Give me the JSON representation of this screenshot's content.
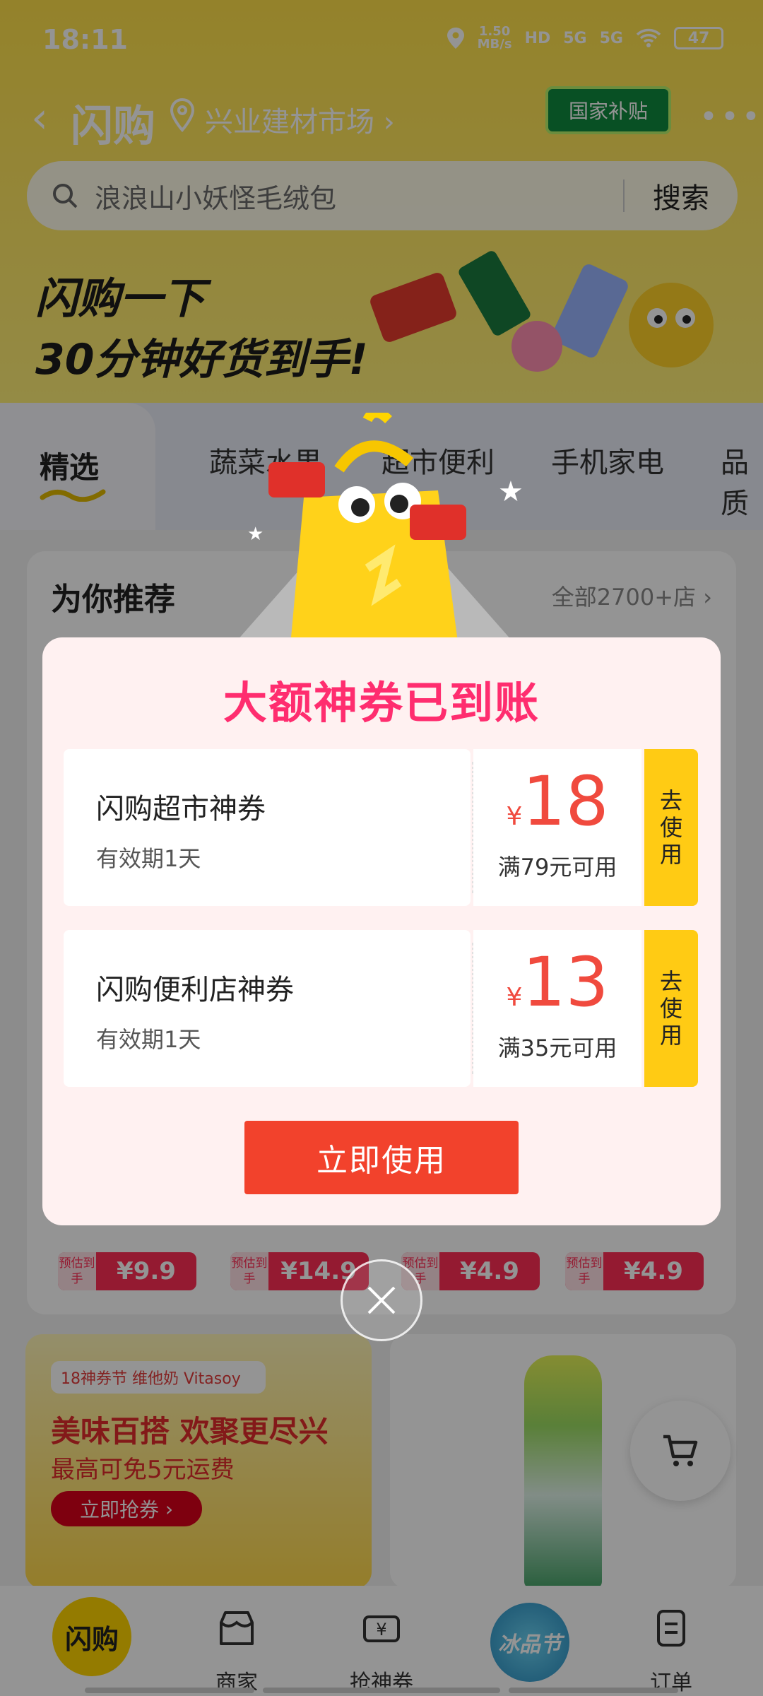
{
  "status_bar": {
    "time": "18:11",
    "speed": "1.50",
    "speed_unit": "MB/s",
    "signal1": "HD",
    "net1": "5G",
    "net2": "5G",
    "battery": "47"
  },
  "header": {
    "title": "闪购",
    "location": "兴业建材市场",
    "subsidy_badge": "国家补贴"
  },
  "search": {
    "placeholder": "浪浪山小妖怪毛绒包",
    "button": "搜索"
  },
  "banner": {
    "slogan_line1": "闪购一下",
    "slogan_line2": "30分钟好货到手!"
  },
  "tabs": {
    "active": "精选",
    "items": [
      "蔬菜水果",
      "超市便利",
      "手机家电",
      "品质"
    ]
  },
  "recommend": {
    "title": "为你推荐",
    "all_label": "全部2700+店"
  },
  "prices": [
    {
      "est": "预估到手",
      "value": "¥9.9"
    },
    {
      "est": "预估到手",
      "value": "¥14.9"
    },
    {
      "est": "预估到手",
      "value": "¥4.9"
    },
    {
      "est": "预估到手",
      "value": "¥4.9"
    }
  ],
  "promo": {
    "chip": "18神券节 维他奶 Vitasoy",
    "title": "美味百搭 欢聚更尽兴",
    "subtitle": "最高可免5元运费",
    "button": "立即抢券"
  },
  "modal": {
    "title": "大额神券已到账",
    "coupons": [
      {
        "name": "闪购超市神券",
        "validity": "有效期1天",
        "currency": "¥",
        "amount": "18",
        "condition": "满79元可用",
        "action": "去使用"
      },
      {
        "name": "闪购便利店神券",
        "validity": "有效期1天",
        "currency": "¥",
        "amount": "13",
        "condition": "满35元可用",
        "action": "去使用"
      }
    ],
    "use_now": "立即使用"
  },
  "bottom_nav": {
    "home": "闪购",
    "merchant": "商家",
    "coupons": "抢神券",
    "ice_festival": "冰品节",
    "orders": "订单"
  },
  "colors": {
    "brand_yellow": "#ffd500",
    "coupon_red": "#f04a3e",
    "title_pink": "#ff2d6f",
    "use_now_btn": "#f2422c",
    "use_tab": "#ffcb14"
  }
}
